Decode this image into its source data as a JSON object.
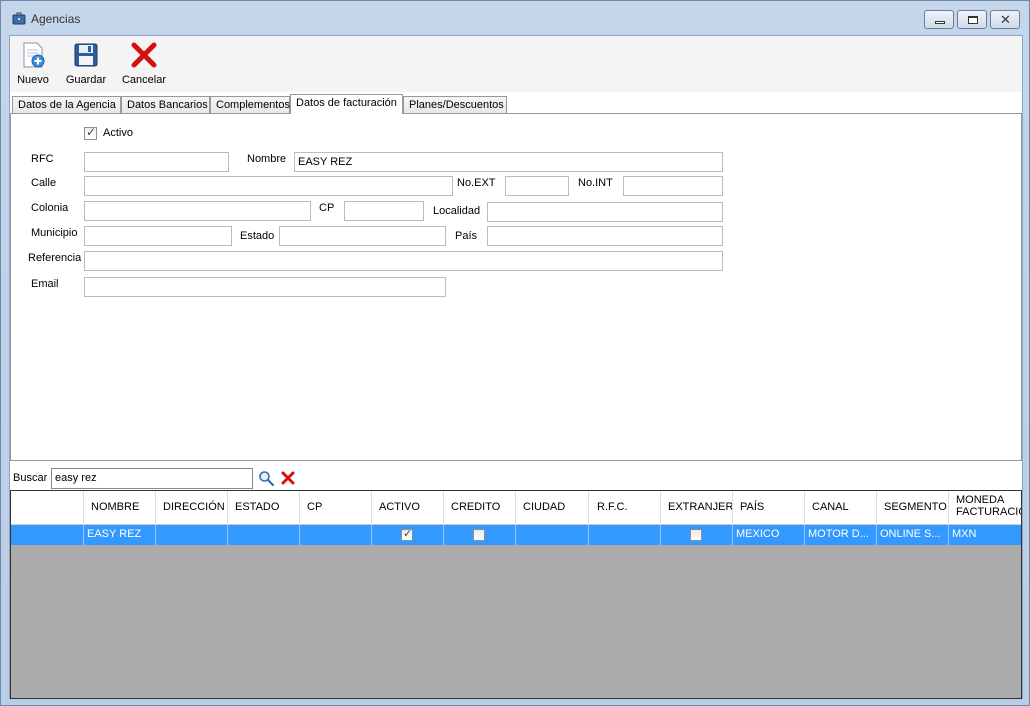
{
  "window": {
    "title": "Agencias"
  },
  "toolbar": {
    "nuevo_label": "Nuevo",
    "guardar_label": "Guardar",
    "cancelar_label": "Cancelar"
  },
  "tabs": [
    {
      "label": "Datos de la Agencia"
    },
    {
      "label": "Datos Bancarios"
    },
    {
      "label": "Complementos"
    },
    {
      "label": "Datos de facturación",
      "active": true
    },
    {
      "label": "Planes/Descuentos"
    }
  ],
  "form": {
    "activo_label": "Activo",
    "activo_checked": true,
    "rfc_label": "RFC",
    "rfc_value": "",
    "nombre_label": "Nombre",
    "nombre_value": "EASY REZ",
    "calle_label": "Calle",
    "calle_value": "",
    "noext_label": "No.EXT",
    "noext_value": "",
    "noint_label": "No.INT",
    "noint_value": "",
    "colonia_label": "Colonia",
    "colonia_value": "",
    "cp_label": "CP",
    "cp_value": "",
    "localidad_label": "Localidad",
    "localidad_value": "",
    "municipio_label": "Municipio",
    "municipio_value": "",
    "estado_label": "Estado",
    "estado_value": "",
    "pais_label": "País",
    "pais_value": "",
    "referencia_label": "Referencia",
    "referencia_value": "",
    "email_label": "Email",
    "email_value": ""
  },
  "search": {
    "label": "Buscar",
    "value": "easy rez"
  },
  "grid": {
    "columns": [
      "NOMBRE",
      "DIRECCIÓN",
      "ESTADO",
      "CP",
      "ACTIVO",
      "CREDITO",
      "CIUDAD",
      "R.F.C.",
      "EXTRANJERO",
      "PAÍS",
      "CANAL",
      "SEGMENTO",
      "MONEDA FACTURACIÓN"
    ],
    "row": {
      "nombre": "EASY REZ",
      "direccion": "",
      "estado": "",
      "cp": "",
      "activo": true,
      "credito": false,
      "ciudad": "",
      "rfc": "",
      "extranjero": false,
      "pais": "MEXICO",
      "canal": "MOTOR D...",
      "segmento": "ONLINE S...",
      "moneda": "MXN"
    },
    "selection_color": "#3399ff"
  }
}
